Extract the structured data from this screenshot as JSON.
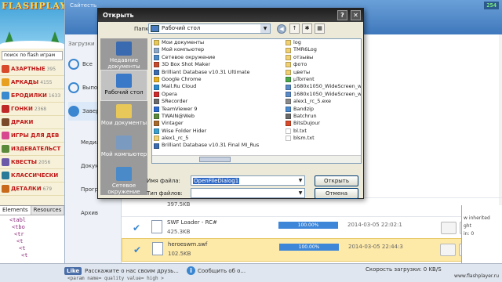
{
  "site": {
    "logo": "FLASHPLAY",
    "search_placeholder": "поиск по flash играм",
    "categories": [
      {
        "label": "АЗАРТНЫЕ",
        "count": "395",
        "color": "#d84a2a"
      },
      {
        "label": "АРКАДЫ",
        "count": "4155",
        "color": "#e8a020"
      },
      {
        "label": "БРОДИЛКИ",
        "count": "1633",
        "color": "#3a8ad0"
      },
      {
        "label": "ГОНКИ",
        "count": "2368",
        "color": "#c02828"
      },
      {
        "label": "ДРАКИ",
        "count": "",
        "color": "#7a4a2a"
      },
      {
        "label": "ИГРЫ ДЛЯ ДЕВ",
        "count": "",
        "color": "#d84890"
      },
      {
        "label": "ИЗДЕВАТЕЛЬСТ",
        "count": "",
        "color": "#5a8a3a"
      },
      {
        "label": "КВЕСТЫ",
        "count": "2056",
        "color": "#6a5aa8"
      },
      {
        "label": "КЛАССИЧЕСКИ",
        "count": "",
        "color": "#2a7a9a"
      },
      {
        "label": "ДЕТАЛКИ",
        "count": "679",
        "color": "#c86a1a"
      }
    ]
  },
  "downloads": {
    "title": "Сайтесть",
    "counter": "254",
    "sidebar_title": "Загрузки",
    "sidebar_items": [
      {
        "label": "Все"
      },
      {
        "label": "Выпол"
      },
      {
        "label": "Завер"
      },
      {
        "label": "Медиа"
      },
      {
        "label": "Докум"
      },
      {
        "label": "Прогр"
      },
      {
        "label": "Архив"
      }
    ],
    "rows": [
      {
        "name": "",
        "size": "397.5KB",
        "progress": "",
        "date": ""
      },
      {
        "name": "SWF Loader - RC#",
        "size": "425.3KB",
        "progress": "100.00%",
        "date": "2014-03-05 22:02:1"
      },
      {
        "name": "heroeswm.swf",
        "size": "102.5KB",
        "progress": "100.00%",
        "date": "2014-03-05 22:44:3"
      }
    ]
  },
  "devtools": {
    "tabs": [
      "Elements",
      "Resources"
    ],
    "code_lines": [
      "<tabl",
      "<tbo",
      "<tr",
      "<t",
      "<t",
      "<t"
    ],
    "css_lines": [
      "w inherited",
      "ght",
      "in: 0"
    ]
  },
  "statusbar": {
    "like": "Like",
    "share_text": "Расскажите о нас своим друзь...",
    "report_text": "Сообщить об о...",
    "speed_text": "Скорость загрузки: 0 KB/S",
    "code_text": "<param name= quality value= high >",
    "url": "www.flashplayer.ru"
  },
  "dialog": {
    "title": "Открыть",
    "lookin_label": "Папка:",
    "lookin_value": "Рабочий стол",
    "places": [
      {
        "label": "Недавние документы",
        "color": "#3a6ab0"
      },
      {
        "label": "Рабочий стол",
        "color": "#3a78c8"
      },
      {
        "label": "Мои документы",
        "color": "#e8c858"
      },
      {
        "label": "Мой компьютер",
        "color": "#7a9ac0"
      },
      {
        "label": "Сетевое окружение",
        "color": "#4a8ac8"
      }
    ],
    "files_col1": [
      {
        "name": "Мои документы",
        "color": "#e8c858"
      },
      {
        "name": "Мой компьютер",
        "color": "#8aa8c8"
      },
      {
        "name": "Сетевое окружение",
        "color": "#4a8ac8"
      },
      {
        "name": "3D Box Shot Maker",
        "color": "#c84a2a"
      },
      {
        "name": "Brilliant Database v10.31 Ultimate",
        "color": "#3a6ab0"
      },
      {
        "name": "Google Chrome",
        "color": "#e8b020"
      },
      {
        "name": "Mail.Ru Cloud",
        "color": "#2a8ad0"
      },
      {
        "name": "Opera",
        "color": "#d02a2a"
      },
      {
        "name": "SRecorder",
        "color": "#6a6a6a"
      },
      {
        "name": "TeamViewer 9",
        "color": "#2a6ad0"
      },
      {
        "name": "TWAIN@Web",
        "color": "#5a8a3a"
      },
      {
        "name": "Vintager",
        "color": "#a86a2a"
      },
      {
        "name": "Wise Folder Hider",
        "color": "#3aa0d0"
      },
      {
        "name": "alex1_rc_5",
        "color": "#f0d070"
      },
      {
        "name": "Brilliant Database v10.31 Final MI_Rus",
        "color": "#3a6ab0"
      }
    ],
    "files_col2": [
      {
        "name": "log",
        "color": "#f0d070"
      },
      {
        "name": "TMR6Log",
        "color": "#f0d070"
      },
      {
        "name": "отзывы",
        "color": "#f0d070"
      },
      {
        "name": "фото",
        "color": "#f0d070"
      },
      {
        "name": "цветы",
        "color": "#f0d070"
      },
      {
        "name": "µTorrent",
        "color": "#4aa84a"
      },
      {
        "name": "1680x1050_WideScreen_wall",
        "color": "#5a8ac8"
      },
      {
        "name": "1680x1050_WideScreen_wall",
        "color": "#5a8ac8"
      },
      {
        "name": "alex1_rc_5.exe",
        "color": "#8a8a8a"
      },
      {
        "name": "Bandzip",
        "color": "#4a8ad0"
      },
      {
        "name": "Batchrun",
        "color": "#6a6a6a"
      },
      {
        "name": "BitsDuJour",
        "color": "#d84a2a"
      },
      {
        "name": "bl.txt",
        "color": "#ffffff"
      },
      {
        "name": "blsm.txt",
        "color": "#ffffff"
      }
    ],
    "filename_label": "Имя файла:",
    "filename_value": "OpenFileDialog1",
    "filetype_label": "Тип файлов:",
    "filetype_value": "",
    "open_button": "Открыть",
    "cancel_button": "Отмена"
  }
}
